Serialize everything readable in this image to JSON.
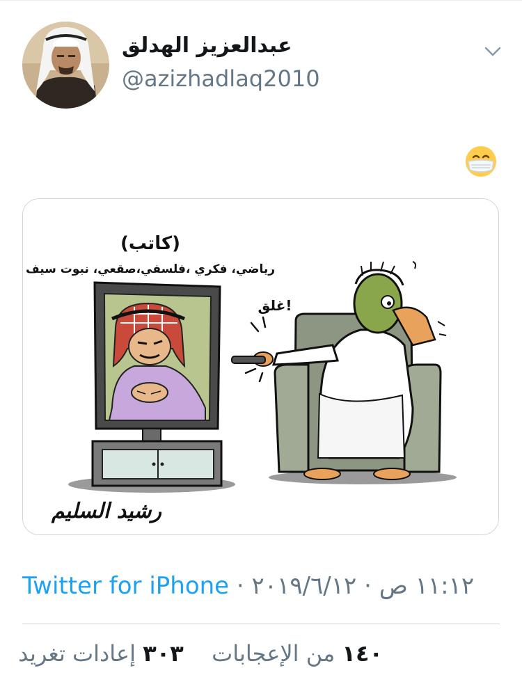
{
  "tweet": {
    "author": {
      "display_name": "عبدالعزيز الهدلق",
      "handle": "@azizhadlaq2010"
    },
    "text_emoji": "face-with-medical-mask",
    "image": {
      "caption_title": "(كاتب)",
      "caption_subtitle": "رياضي، فكري ،فلسفي،صقعي، نبوت سيف",
      "speech": "غلق!",
      "signature": "رشيد السليم"
    },
    "meta": {
      "time": "١١:١٢ ص",
      "separator": "·",
      "date": "٢٠١٩/٦/١٢",
      "source": "Twitter for iPhone"
    },
    "stats": {
      "retweets_count": "٣٠٣",
      "retweets_label": "إعادات تغريد",
      "likes_count": "١٤٠",
      "likes_label": "من الإعجابات"
    }
  },
  "colors": {
    "accent": "#1da1f2",
    "secondary_text": "#657786",
    "border": "#ccd6dd"
  }
}
